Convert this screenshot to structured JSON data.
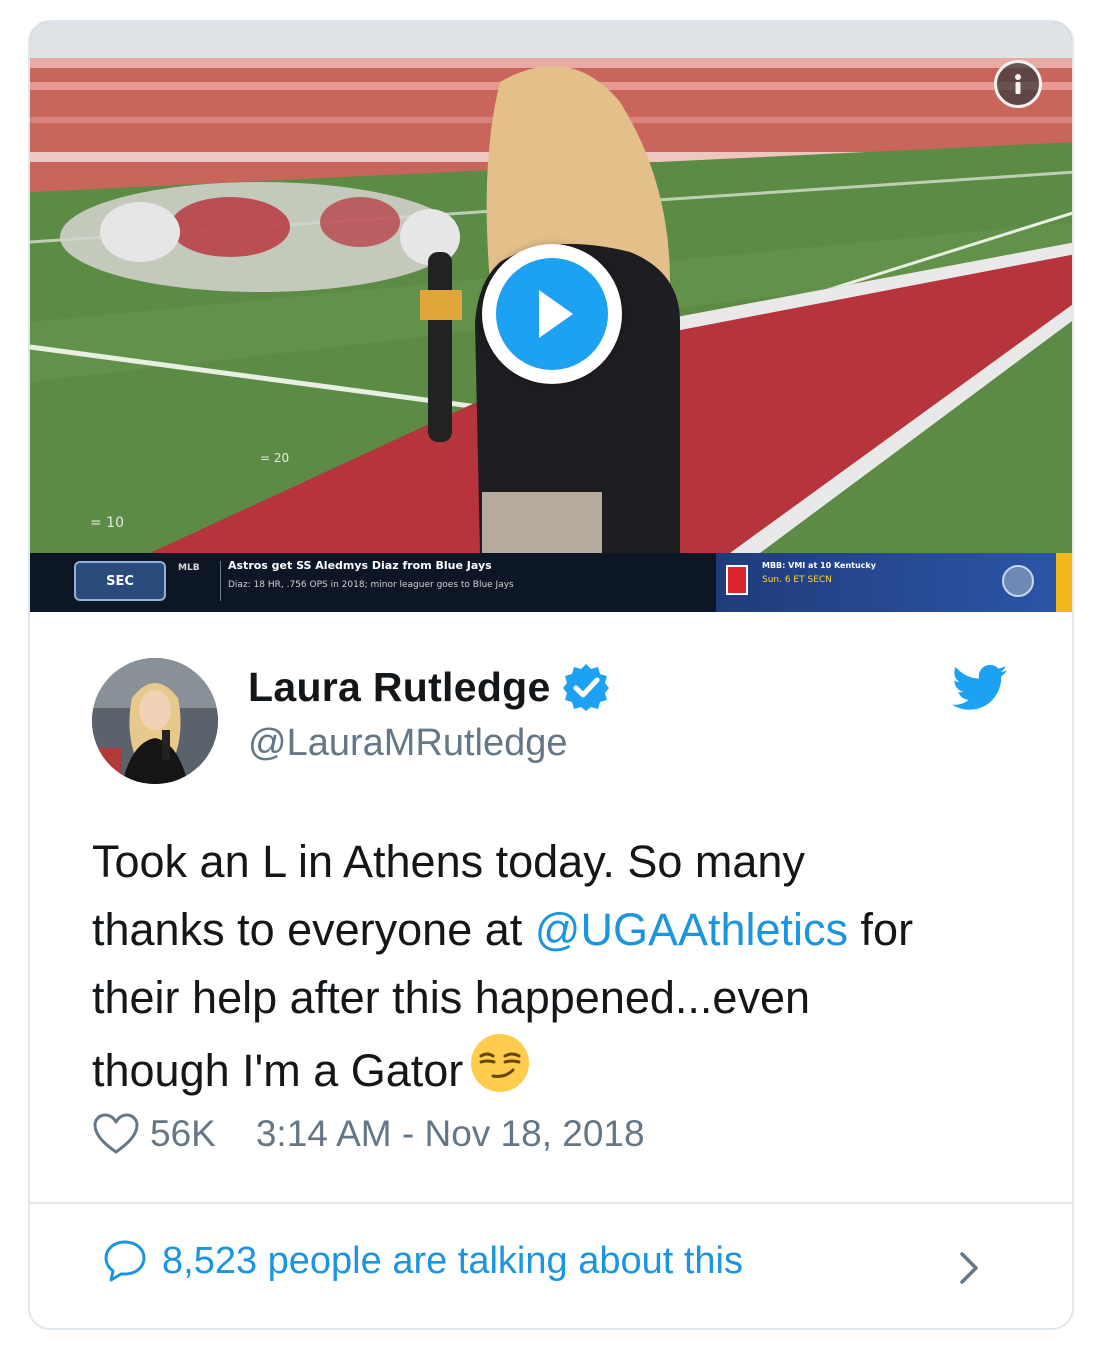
{
  "video": {
    "info_icon": "info-icon",
    "play_icon": "play-icon",
    "ticker": {
      "logo": "SEC",
      "tag": "MLB",
      "headline": "Astros get SS Aledmys Diaz from Blue Jays",
      "subline": "Diaz: 18 HR, .756 OPS in 2018; minor leaguer goes to Blue Jays",
      "right_line1": "MBB: VMI at 10 Kentucky",
      "right_line2": "Sun. 6 ET SECN"
    }
  },
  "tweet": {
    "display_name": "Laura Rutledge",
    "handle": "@LauraMRutledge",
    "verified_icon": "verified-badge-icon",
    "platform_icon": "twitter-bird-icon",
    "text_line1": "Took an L in Athens today. So many",
    "text_line2_before": "thanks to everyone at ",
    "text_mention": "@UGAAthletics",
    "text_line2_after": " for",
    "text_line3": "their help after this happened...even",
    "text_line4": "though I'm a Gator",
    "emoji_icon": "smirking-face-icon",
    "likes": "56K",
    "timestamp": "3:14 AM - Nov 18, 2018",
    "talking": "8,523 people are talking about this"
  },
  "colors": {
    "accent": "#1da1f2",
    "link": "#1b95e0",
    "muted": "#657786",
    "border": "#e1e8ed"
  }
}
